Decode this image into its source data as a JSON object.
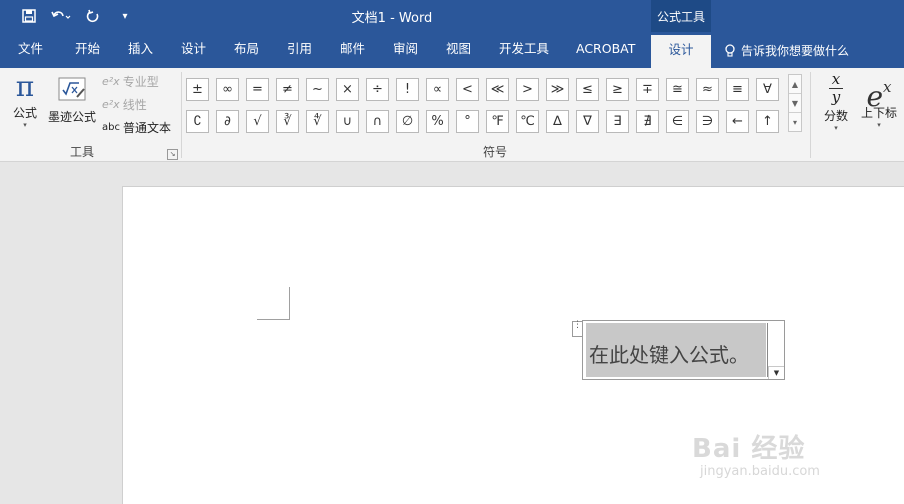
{
  "titlebar": {
    "title": "文档1 - Word",
    "context_tools": "公式工具",
    "qat": {
      "save_icon": "save-icon",
      "undo_icon": "undo-icon",
      "redo_icon": "redo-icon",
      "customize": "▾"
    }
  },
  "tabs": [
    {
      "label": "文件"
    },
    {
      "label": "开始"
    },
    {
      "label": "插入"
    },
    {
      "label": "设计"
    },
    {
      "label": "布局"
    },
    {
      "label": "引用"
    },
    {
      "label": "邮件"
    },
    {
      "label": "审阅"
    },
    {
      "label": "视图"
    },
    {
      "label": "开发工具"
    },
    {
      "label": "ACROBAT"
    },
    {
      "label": "设计"
    }
  ],
  "tell_me": "告诉我你想要做什么",
  "ribbon": {
    "tools": {
      "group_label": "工具",
      "equation": {
        "glyph": "π",
        "label": "公式"
      },
      "ink": {
        "label": "墨迹公式"
      },
      "professional": "专业型",
      "linear": "线性",
      "normal_text": "普通文本",
      "abc": "abc"
    },
    "symbols": {
      "group_label": "符号",
      "row1": [
        "±",
        "∞",
        "=",
        "≠",
        "~",
        "×",
        "÷",
        "!",
        "∝",
        "<",
        "≪",
        ">",
        "≫",
        "≤",
        "≥",
        "∓",
        "≅",
        "≈",
        "≡",
        "∀"
      ],
      "row2": [
        "∁",
        "∂",
        "√",
        "∛",
        "∜",
        "∪",
        "∩",
        "∅",
        "%",
        "°",
        "℉",
        "℃",
        "∆",
        "∇",
        "∃",
        "∄",
        "∈",
        "∋",
        "←",
        "↑"
      ]
    },
    "structures": {
      "fraction": {
        "label": "分数",
        "top": "x",
        "bottom": "y"
      },
      "script": {
        "label": "上下标",
        "base": "e",
        "sup": "x"
      }
    }
  },
  "document": {
    "equation_placeholder": "在此处键入公式。"
  },
  "watermark": {
    "brand": "Bai  经验",
    "url": "jingyan.baidu.com"
  }
}
